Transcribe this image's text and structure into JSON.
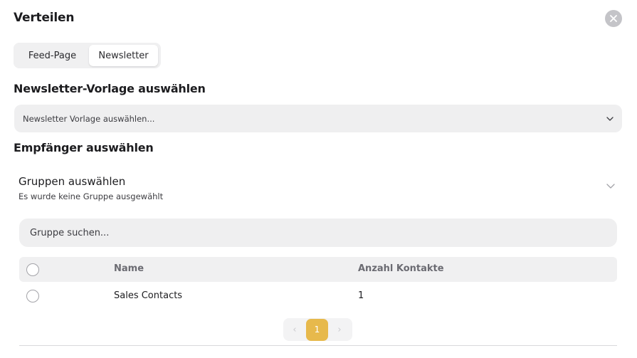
{
  "dialog": {
    "title": "Verteilen"
  },
  "tabs": [
    {
      "label": "Feed-Page",
      "active": false
    },
    {
      "label": "Newsletter",
      "active": true
    }
  ],
  "template_section": {
    "title": "Newsletter-Vorlage auswählen",
    "select_placeholder": "Newsletter Vorlage auswählen..."
  },
  "recipients_section": {
    "title": "Empfänger auswählen",
    "groups": {
      "title": "Gruppen auswählen",
      "subtitle": "Es wurde keine Gruppe ausgewählt",
      "search_placeholder": "Gruppe suchen..."
    }
  },
  "table": {
    "columns": [
      "Name",
      "Anzahl Kontakte"
    ],
    "rows": [
      {
        "name": "Sales Contacts",
        "count": "1",
        "checked": false
      }
    ]
  },
  "pagination": {
    "prev": "‹",
    "current": "1",
    "next": "›"
  },
  "colors": {
    "accent": "#e7b94c",
    "surface": "#efeff0",
    "text": "#1c1c1f"
  },
  "icons": {
    "close": "close-icon",
    "select_chevron": "chevron-down-icon",
    "accordion_chevron": "chevron-down-icon"
  }
}
